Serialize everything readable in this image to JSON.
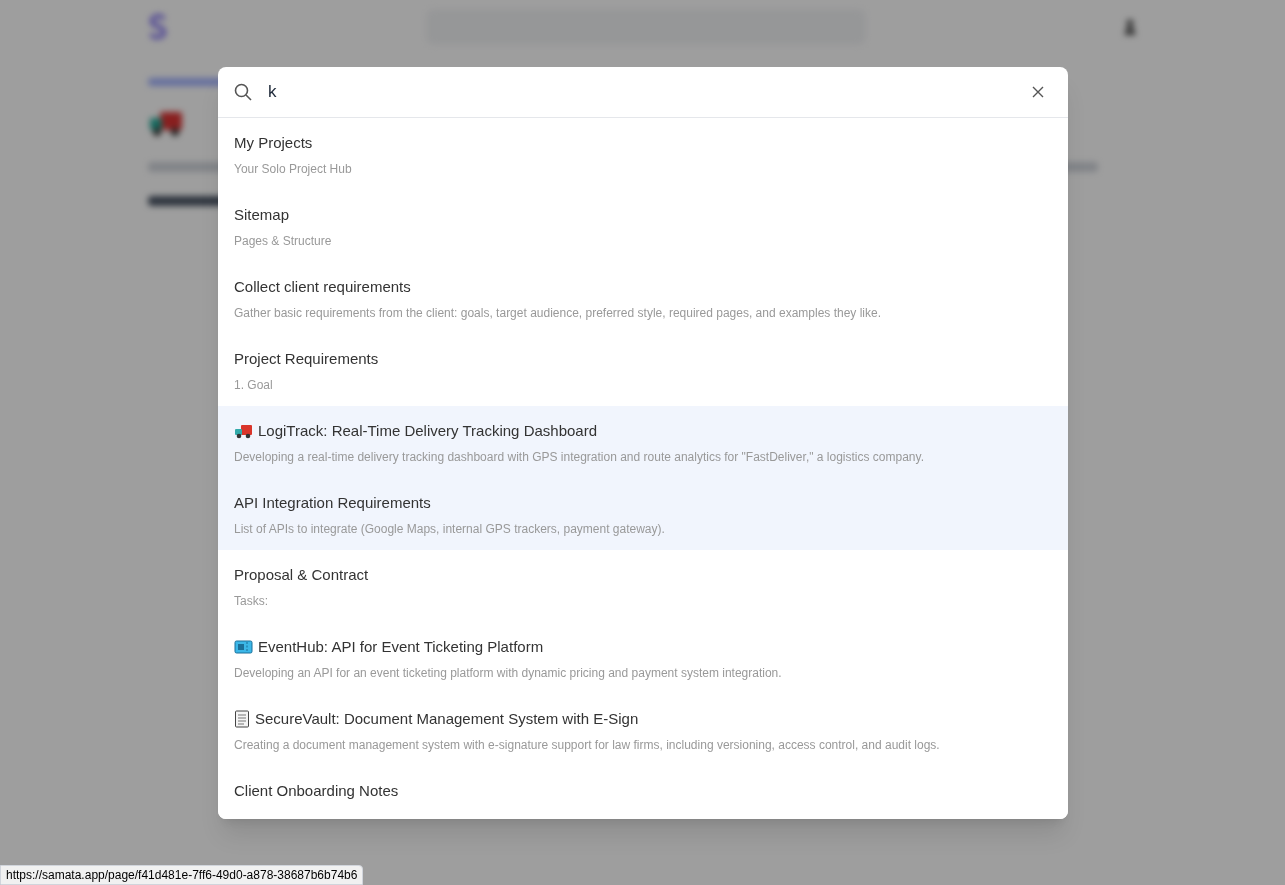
{
  "search": {
    "value": "k"
  },
  "results": [
    {
      "title": "My Projects",
      "description": "Your Solo Project Hub",
      "highlighted": false
    },
    {
      "title": "Sitemap",
      "description": "Pages & Structure",
      "highlighted": false
    },
    {
      "title": "Collect client requirements",
      "description": "Gather basic requirements from the client: goals, target audience, preferred style, required pages, and examples they like.",
      "highlighted": false
    },
    {
      "title": "Project Requirements",
      "description": "1. Goal",
      "highlighted": false
    },
    {
      "kind": "truck",
      "title": "LogiTrack: Real-Time Delivery Tracking Dashboard",
      "description": "Developing a real-time delivery tracking dashboard with GPS integration and route analytics for \"FastDeliver,\" a logistics company.",
      "highlighted": true
    },
    {
      "title": "API Integration Requirements",
      "description": "List of APIs to integrate (Google Maps, internal GPS trackers, payment gateway).",
      "highlighted": true
    },
    {
      "title": "Proposal & Contract",
      "description": "Tasks:",
      "highlighted": false
    },
    {
      "kind": "ticket",
      "title": "EventHub: API for Event Ticketing Platform",
      "description": "Developing an API for an event ticketing platform with dynamic pricing and payment system integration.",
      "highlighted": false
    },
    {
      "kind": "document",
      "title": "SecureVault: Document Management System with E-Sign",
      "description": "Creating a document management system with e-signature support for law firms, including versioning, access control, and audit logs.",
      "highlighted": false
    },
    {
      "title": "Client Onboarding Notes",
      "highlighted": false
    }
  ],
  "status_bar": {
    "url": "https://samata.app/page/f41d481e-7ff6-49d0-a878-38687b6b74b6"
  }
}
